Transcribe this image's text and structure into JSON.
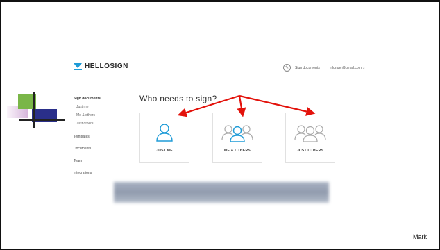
{
  "brand": {
    "name": "HELLOSIGN",
    "accent": "#1e9bd7"
  },
  "topnav": {
    "sign_documents": "Sign documents",
    "email": "mlunger@gmail.com ⌄"
  },
  "sidebar": {
    "items": [
      {
        "label": "Sign documents"
      },
      {
        "label": "Just me"
      },
      {
        "label": "Me & others"
      },
      {
        "label": "Just others"
      },
      {
        "label": "Templates"
      },
      {
        "label": "Documents"
      },
      {
        "label": "Team"
      },
      {
        "label": "Integrations"
      }
    ]
  },
  "main": {
    "heading": "Who needs to sign?",
    "options": [
      {
        "label": "JUST ME",
        "icon": "single-person-icon"
      },
      {
        "label": "ME & OTHERS",
        "icon": "group-with-me-icon"
      },
      {
        "label": "JUST OTHERS",
        "icon": "group-others-icon"
      }
    ]
  },
  "annotations": {
    "arrow_color": "#e3120b"
  },
  "speaker": "Mark"
}
